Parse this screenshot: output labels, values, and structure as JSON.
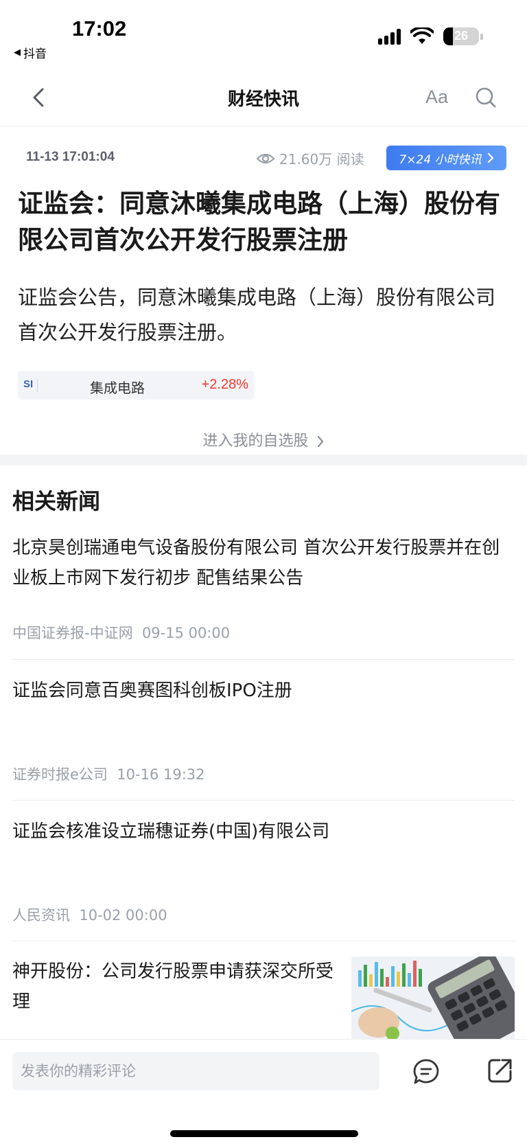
{
  "status_bar": {
    "time": "17:02",
    "back_app_label": "抖音",
    "battery_level": "26",
    "battery_fraction": 0.26
  },
  "nav": {
    "title": "财经快讯",
    "font_label": "Aa",
    "icons": {
      "back": "chevron-left-icon",
      "search": "search-icon"
    }
  },
  "article": {
    "date": "11-13 17:01:04",
    "views": "21.60万 阅读",
    "badge": "7×24 小时快讯",
    "headline": "证监会：同意沐曦集成电路（上海）股份有限公司首次公开发行股票注册",
    "summary": "证监会公告，同意沐曦集成电路（上海）股份有限公司首次公开发行股票注册。",
    "stock": {
      "code": "SI",
      "name": "集成电路",
      "change": "+2.28%",
      "change_color": "#f0382d"
    },
    "watchlist_link": "进入我的自选股"
  },
  "related": {
    "title": "相关新闻",
    "items": [
      {
        "title": "北京昊创瑞通电气设备股份有限公司 首次公开发行股票并在创业板上市网下发行初步 配售结果公告",
        "source": "中国证券报-中证网",
        "time": "09-15 00:00"
      },
      {
        "title": "证监会同意百奥赛图科创板IPO注册",
        "source": "证券时报e公司",
        "time": "10-16 19:32"
      },
      {
        "title": "证监会核准设立瑞穗证券(中国)有限公司",
        "source": "人民资讯",
        "time": "10-02 00:00"
      },
      {
        "title": "神开股份：公司发行股票申请获深交所受理",
        "thumbnail": "calculator-chart-image"
      }
    ]
  },
  "bottom_bar": {
    "comment_placeholder": "发表你的精彩评论",
    "icons": {
      "comment": "comment-icon",
      "share": "share-icon"
    }
  },
  "colors": {
    "accent_blue": "#3e7bef",
    "up_red": "#f0382d",
    "muted_text": "#9aa0aa"
  }
}
